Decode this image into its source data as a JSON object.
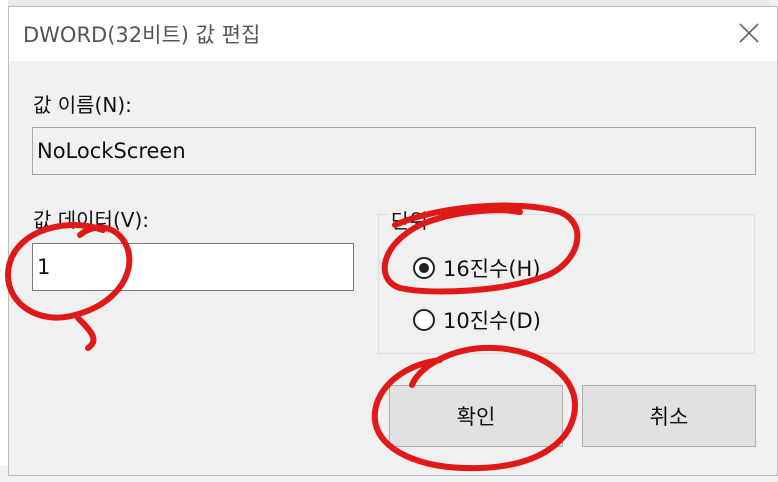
{
  "dialog": {
    "title": "DWORD(32비트) 값 편집",
    "close_icon": "close-icon",
    "value_name_label": "값 이름(N):",
    "value_name": "NoLockScreen",
    "value_data_label": "값 데이터(V):",
    "value_data": "1",
    "base_group_label": "단위",
    "base_options": [
      {
        "label": "16진수(H)",
        "checked": true
      },
      {
        "label": "10진수(D)",
        "checked": false
      }
    ],
    "ok_label": "확인",
    "cancel_label": "취소"
  },
  "annotations": {
    "color": "#e01818",
    "shape": "hand-drawn-circle"
  }
}
